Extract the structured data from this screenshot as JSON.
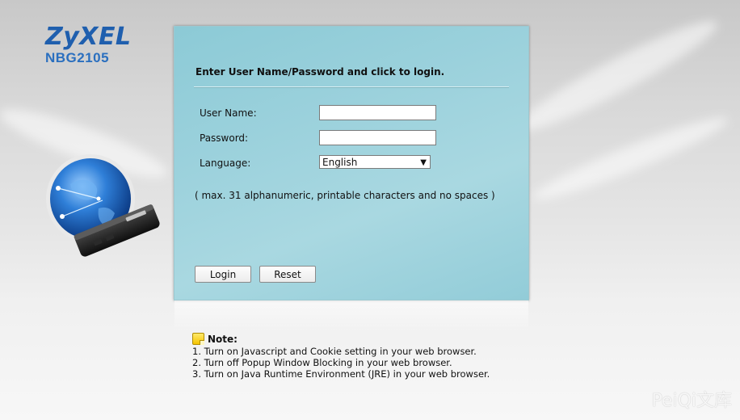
{
  "brand": {
    "logo": "ZyXEL",
    "model": "NBG2105"
  },
  "login": {
    "title": "Enter User Name/Password and click to login.",
    "username_label": "User Name:",
    "username_value": "",
    "password_label": "Password:",
    "password_value": "",
    "language_label": "Language:",
    "language_selected": "English",
    "hint": "( max. 31 alphanumeric, printable characters and no spaces )",
    "login_button": "Login",
    "reset_button": "Reset"
  },
  "note": {
    "heading": "Note:",
    "lines": [
      "1. Turn on Javascript and Cookie setting in your web browser.",
      "2. Turn off Popup Window Blocking in your web browser.",
      "3. Turn on Java Runtime Environment (JRE) in your web browser."
    ]
  },
  "watermark": "PeiQi文库",
  "colors": {
    "brand_blue": "#1f5fae",
    "panel_teal": "#9bd1dc"
  },
  "icons": {
    "note": "note-icon",
    "select_arrow": "chevron-down-icon",
    "device": "globe-router-illustration"
  }
}
